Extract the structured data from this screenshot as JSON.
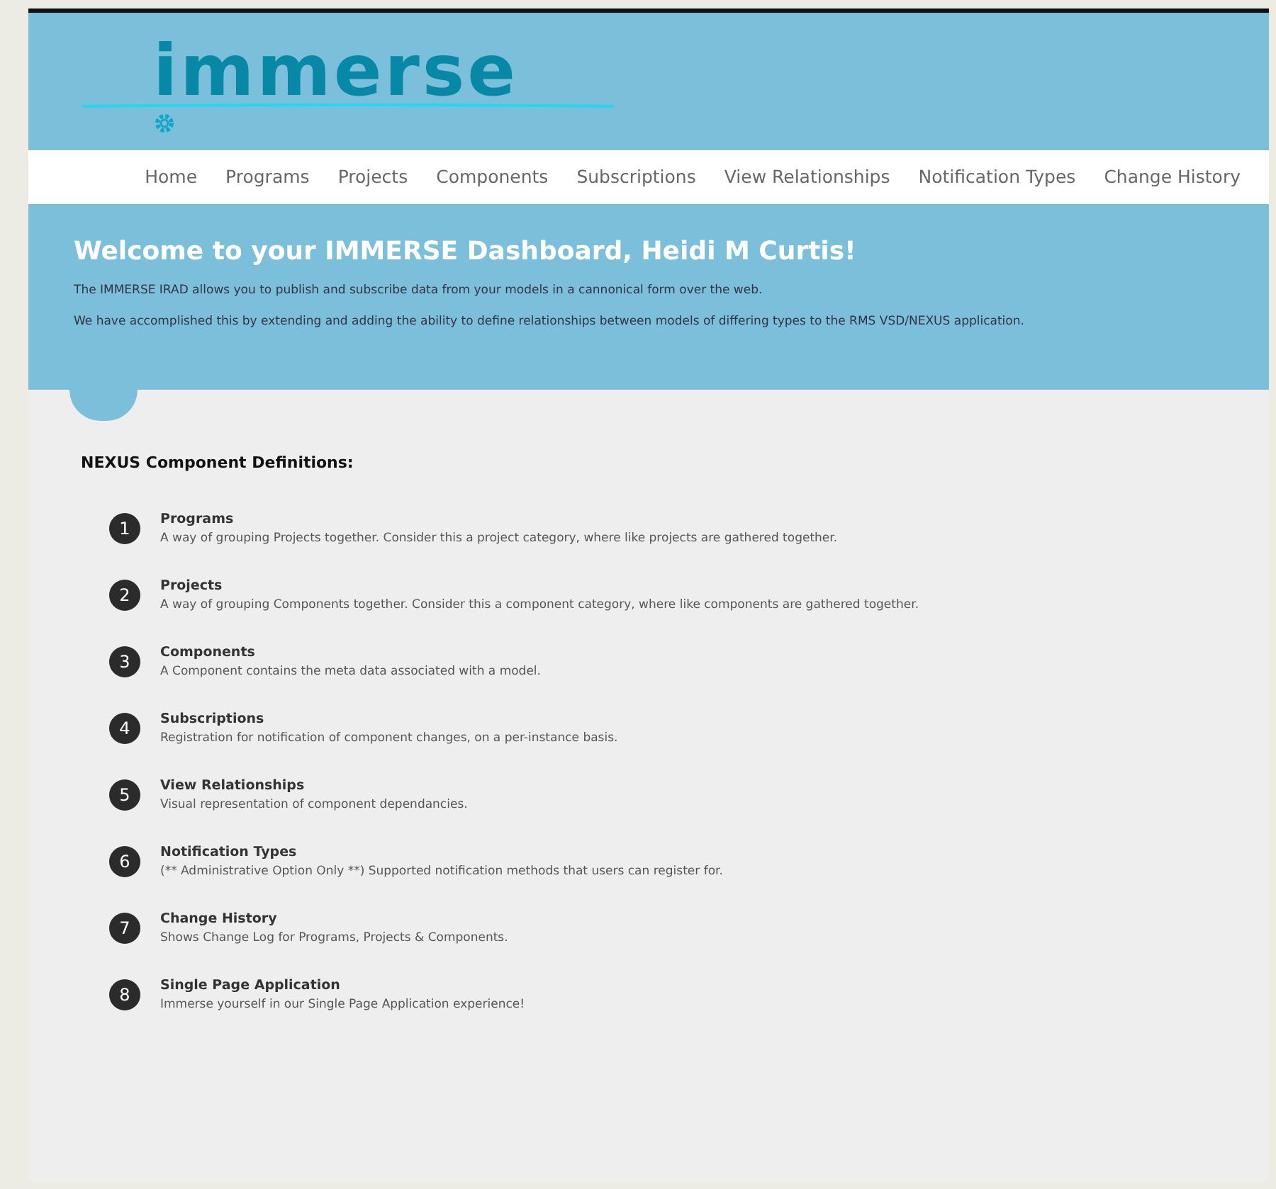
{
  "logo": {
    "text": "immerse"
  },
  "nav": [
    {
      "label": "Home"
    },
    {
      "label": "Programs"
    },
    {
      "label": "Projects"
    },
    {
      "label": "Components"
    },
    {
      "label": "Subscriptions"
    },
    {
      "label": "View Relationships"
    },
    {
      "label": "Notification Types"
    },
    {
      "label": "Change History"
    }
  ],
  "hero": {
    "title": "Welcome to your IMMERSE Dashboard, Heidi M Curtis!",
    "paragraphs": [
      "The IMMERSE IRAD allows you to publish and subscribe data from your models in a cannonical form over the web.",
      "We have accomplished this by extending and adding the ability to define relationships between models of differing types to the RMS VSD/NEXUS application."
    ]
  },
  "definitions": {
    "heading": "NEXUS Component Definitions:",
    "items": [
      {
        "number": "1",
        "title": "Programs",
        "text": "A way of grouping Projects together. Consider this a project category, where like projects are gathered together."
      },
      {
        "number": "2",
        "title": "Projects",
        "text": "A way of grouping Components together. Consider this a component category, where like components are gathered together."
      },
      {
        "number": "3",
        "title": "Components",
        "text": "A Component contains the meta data associated with a model."
      },
      {
        "number": "4",
        "title": "Subscriptions",
        "text": "Registration for notification of component changes, on a per-instance basis."
      },
      {
        "number": "5",
        "title": "View Relationships",
        "text": "Visual representation of component dependancies."
      },
      {
        "number": "6",
        "title": "Notification Types",
        "text": "(** Administrative Option Only **) Supported notification methods that users can register for."
      },
      {
        "number": "7",
        "title": "Change History",
        "text": "Shows Change Log for Programs, Projects & Components."
      },
      {
        "number": "8",
        "title": "Single Page Application",
        "text": "Immerse yourself in our Single Page Application experience!"
      }
    ]
  }
}
